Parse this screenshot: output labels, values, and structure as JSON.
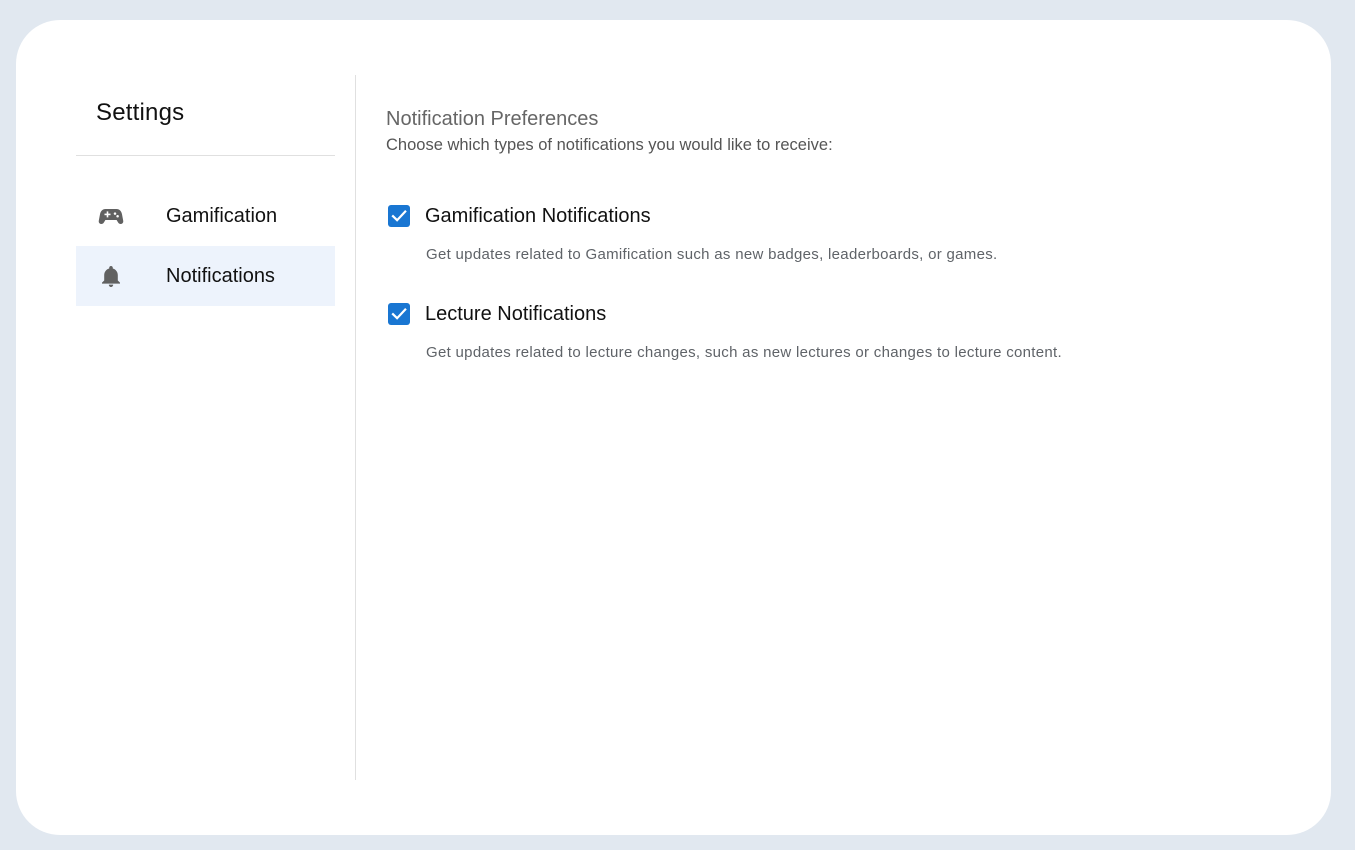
{
  "sidebar": {
    "title": "Settings",
    "items": [
      {
        "label": "Gamification",
        "icon": "gamepad-icon",
        "active": false
      },
      {
        "label": "Notifications",
        "icon": "bell-icon",
        "active": true
      }
    ]
  },
  "main": {
    "title": "Notification Preferences",
    "subtitle": "Choose which types of notifications you would like to receive:",
    "options": [
      {
        "label": "Gamification Notifications",
        "description": "Get updates related to Gamification such as new badges, leaderboards, or games.",
        "checked": true
      },
      {
        "label": "Lecture Notifications",
        "description": "Get updates related to lecture changes, such as new lectures or changes to lecture content.",
        "checked": true
      }
    ]
  },
  "colors": {
    "background": "#e1e8f0",
    "card": "#ffffff",
    "accent": "#1976d2",
    "active_item": "#edf3fc",
    "icon": "#616161"
  }
}
